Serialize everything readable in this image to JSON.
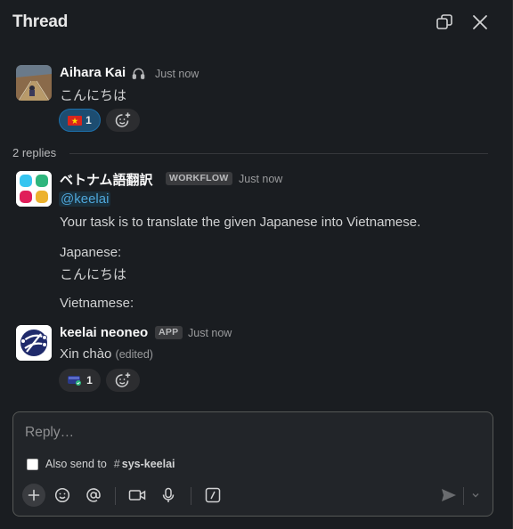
{
  "header": {
    "title": "Thread"
  },
  "parent": {
    "author": "Aihara Kai",
    "time": "Just now",
    "text": "こんにちは",
    "reaction_count": "1"
  },
  "replies_label": "2 replies",
  "workflow_msg": {
    "author": "ベトナム語翻訳",
    "badge": "WORKFLOW",
    "time": "Just now",
    "mention": "@keelai",
    "line1": "Your task is to translate the given Japanese into Vietnamese.",
    "line2": "Japanese:",
    "line3": "こんにちは",
    "line4": "Vietnamese:"
  },
  "app_msg": {
    "author": "keelai neoneo",
    "badge": "APP",
    "time": "Just now",
    "text": "Xin chào",
    "edited": "(edited)",
    "reaction_count": "1"
  },
  "composer": {
    "placeholder": "Reply…",
    "also_send": "Also send to",
    "channel": "sys-keelai"
  },
  "colors": {
    "accent": "#1d9bd1",
    "background": "#1a1d21"
  }
}
